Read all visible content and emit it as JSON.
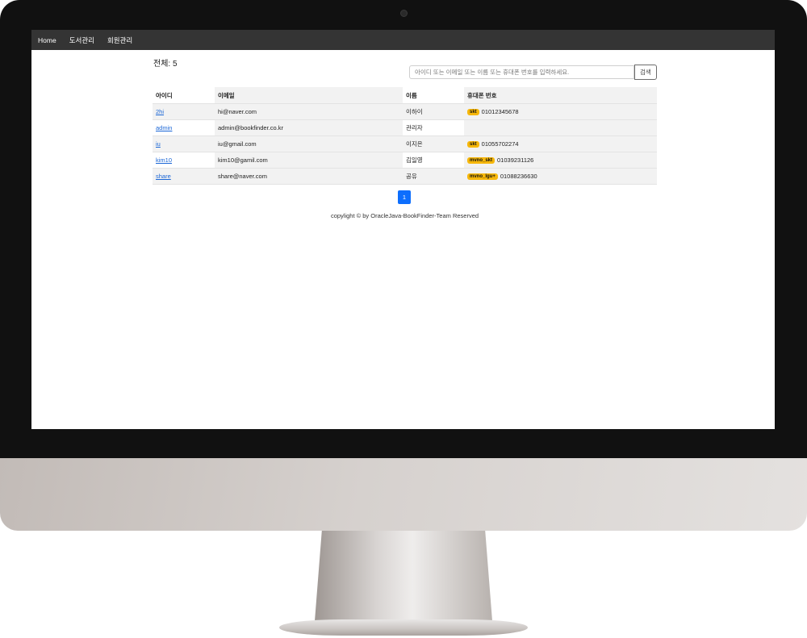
{
  "nav": {
    "items": [
      "Home",
      "도서관리",
      "회원관리"
    ]
  },
  "summary": {
    "total_label": "전체: 5"
  },
  "search": {
    "placeholder": "아이디 또는 이메일 또는 이름 또는 휴대폰 번호를 입력하세요.",
    "button_label": "검색"
  },
  "table": {
    "headers": [
      "아이디",
      "이메일",
      "이름",
      "휴대폰 번호"
    ],
    "rows": [
      {
        "id": "2hi",
        "email": "hi@naver.com",
        "name": "이하이",
        "carrier": "skt",
        "phone": "01012345678"
      },
      {
        "id": "admin",
        "email": "admin@bookfinder.co.kr",
        "name": "관리자",
        "carrier": "",
        "phone": ""
      },
      {
        "id": "iu",
        "email": "iu@gmail.com",
        "name": "이지은",
        "carrier": "skt",
        "phone": "01055702274"
      },
      {
        "id": "kim10",
        "email": "kim10@gamil.com",
        "name": "김일영",
        "carrier": "mvno_skt",
        "phone": "01039231126"
      },
      {
        "id": "share",
        "email": "share@naver.com",
        "name": "공유",
        "carrier": "mvno_lgu+",
        "phone": "01088236630"
      }
    ]
  },
  "pagination": {
    "current": "1"
  },
  "footer": {
    "text": "copylight © by OracleJava-BookFinder-Team Reserved"
  },
  "colors": {
    "navbar": "#343434",
    "link": "#1a66d6",
    "badge": "#f6b70b",
    "pager": "#0d6efd"
  }
}
